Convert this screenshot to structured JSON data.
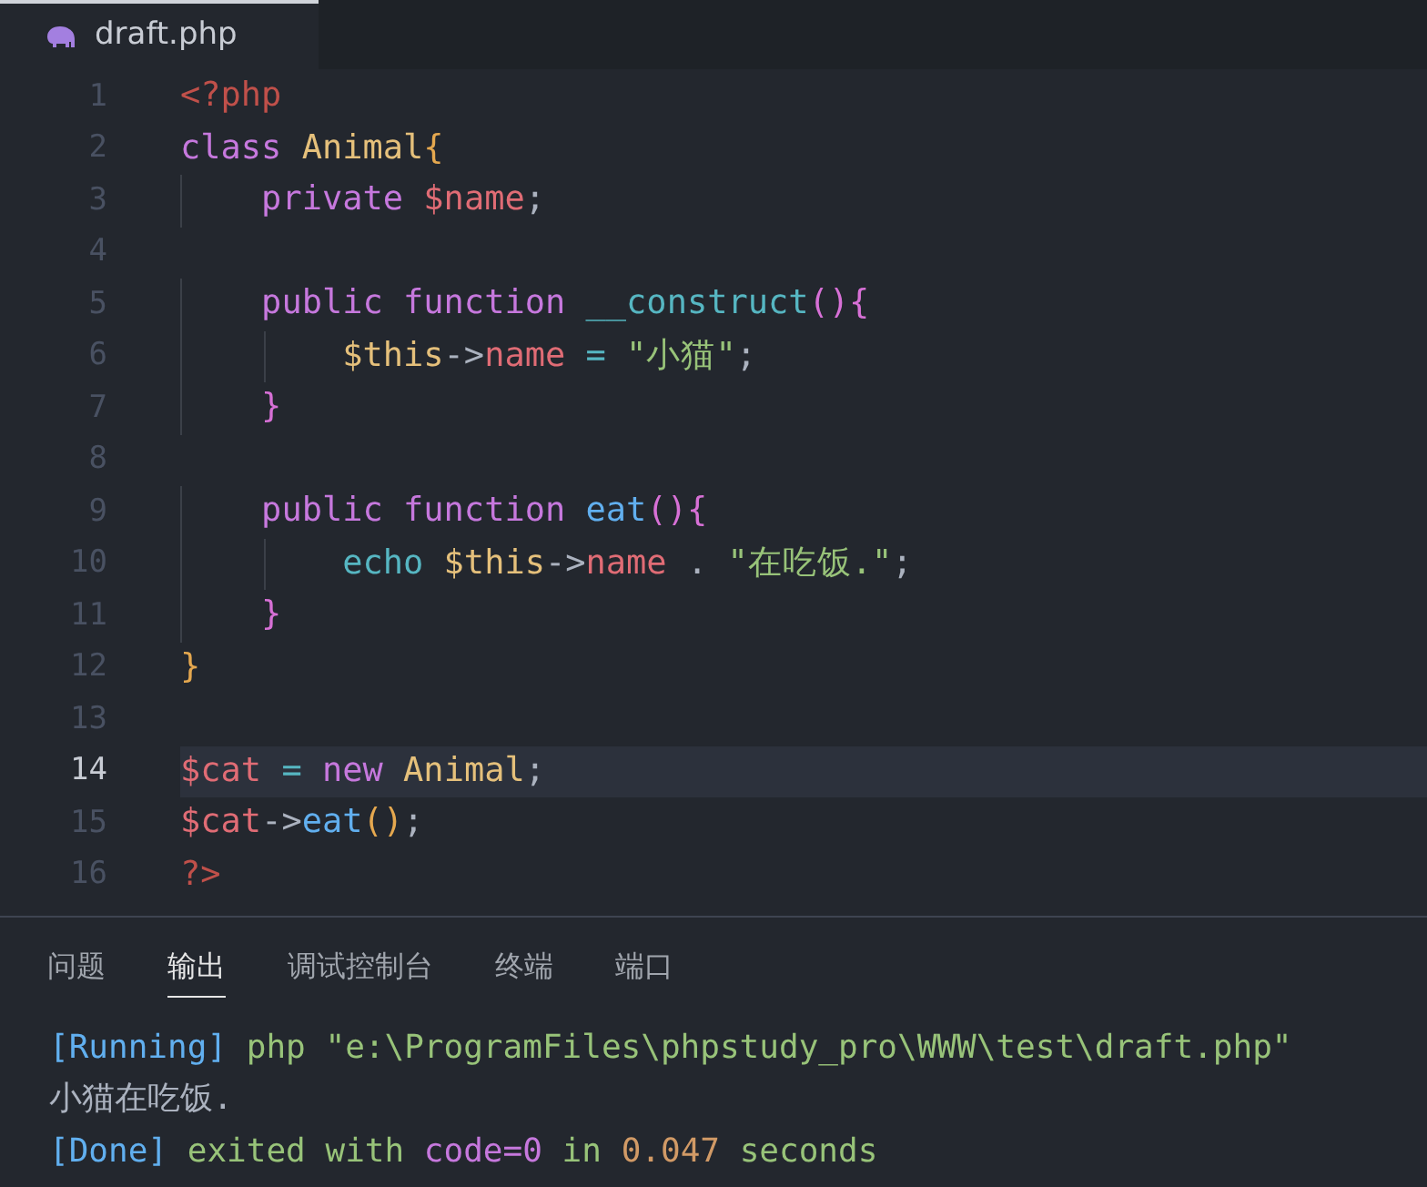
{
  "editor_tab": {
    "label": "draft.php",
    "selected": true
  },
  "code_lines": [
    {
      "number": "1",
      "active": false,
      "tokens": [
        {
          "text": "<?php",
          "kind": "tag"
        }
      ]
    },
    {
      "number": "2",
      "active": false,
      "tokens": [
        {
          "text": "class",
          "kind": "keyword"
        },
        {
          "text": " Animal",
          "kind": "class"
        },
        {
          "text": "{",
          "kind": "bracket1"
        }
      ]
    },
    {
      "number": "3",
      "active": false,
      "tokens": [
        {
          "text": "    private",
          "kind": "keyword"
        },
        {
          "text": " $name",
          "kind": "variable"
        },
        {
          "text": ";",
          "kind": "punct"
        }
      ]
    },
    {
      "number": "4",
      "active": false
    },
    {
      "number": "5",
      "active": false,
      "tokens": [
        {
          "text": "    public function",
          "kind": "keyword"
        },
        {
          "text": " __construct",
          "kind": "function"
        },
        {
          "text": "(){",
          "kind": "bracket2"
        }
      ]
    },
    {
      "number": "6",
      "active": false,
      "tokens": [
        {
          "text": "        $this",
          "kind": "this"
        },
        {
          "text": "->",
          "kind": "operator2"
        },
        {
          "text": "name",
          "kind": "variable"
        },
        {
          "text": " =",
          "kind": "operator"
        },
        {
          "text": " \"小猫\"",
          "kind": "string"
        },
        {
          "text": ";",
          "kind": "punct"
        }
      ]
    },
    {
      "number": "7",
      "active": false,
      "tokens": [
        {
          "text": "    }",
          "kind": "bracket2"
        }
      ]
    },
    {
      "number": "8",
      "active": false
    },
    {
      "number": "9",
      "active": false,
      "tokens": [
        {
          "text": "    public function",
          "kind": "keyword"
        },
        {
          "text": " eat",
          "kind": "method"
        },
        {
          "text": "(){",
          "kind": "bracket2"
        }
      ]
    },
    {
      "number": "10",
      "active": false,
      "tokens": [
        {
          "text": "        echo",
          "kind": "function"
        },
        {
          "text": " $this",
          "kind": "this"
        },
        {
          "text": "->",
          "kind": "operator2"
        },
        {
          "text": "name",
          "kind": "variable"
        },
        {
          "text": " .",
          "kind": "punct"
        },
        {
          "text": " \"在吃饭.\"",
          "kind": "string"
        },
        {
          "text": ";",
          "kind": "punct"
        }
      ]
    },
    {
      "number": "11",
      "active": false,
      "tokens": [
        {
          "text": "    }",
          "kind": "bracket2"
        }
      ]
    },
    {
      "number": "12",
      "active": false,
      "tokens": [
        {
          "text": "}",
          "kind": "bracket1"
        }
      ]
    },
    {
      "number": "13",
      "active": false
    },
    {
      "number": "14",
      "active": true,
      "tokens": [
        {
          "text": "$cat",
          "kind": "variable"
        },
        {
          "text": " =",
          "kind": "operator"
        },
        {
          "text": " new",
          "kind": "keyword"
        },
        {
          "text": " Animal",
          "kind": "class"
        },
        {
          "text": ";",
          "kind": "punct"
        }
      ]
    },
    {
      "number": "15",
      "active": false,
      "tokens": [
        {
          "text": "$cat",
          "kind": "variable"
        },
        {
          "text": "->",
          "kind": "operator2"
        },
        {
          "text": "eat",
          "kind": "method"
        },
        {
          "text": "()",
          "kind": "bracket1"
        },
        {
          "text": ";",
          "kind": "punct"
        }
      ]
    },
    {
      "number": "16",
      "active": false,
      "tokens": [
        {
          "text": "?>",
          "kind": "tag"
        }
      ]
    }
  ],
  "panel_tabs": [
    {
      "label": "问题",
      "selected": false
    },
    {
      "label": "输出",
      "selected": true
    },
    {
      "label": "调试控制台",
      "selected": false
    },
    {
      "label": "终端",
      "selected": false
    },
    {
      "label": "端口",
      "selected": false
    }
  ],
  "output_lines": [
    {
      "tokens": [
        {
          "text": "[Running]",
          "kind": "label"
        },
        {
          "text": " php \"e:\\ProgramFiles\\phpstudy_pro\\WWW\\test\\draft.php\"",
          "kind": "text"
        }
      ]
    },
    {
      "tokens": [
        {
          "text": "小猫在吃饭.",
          "kind": "plain"
        }
      ]
    },
    {
      "tokens": [
        {
          "text": "[Done]",
          "kind": "label"
        },
        {
          "text": " exited with ",
          "kind": "text"
        },
        {
          "text": "code=0",
          "kind": "keyword"
        },
        {
          "text": " in ",
          "kind": "text"
        },
        {
          "text": "0.047",
          "kind": "number"
        },
        {
          "text": " seconds",
          "kind": "text"
        }
      ]
    }
  ]
}
